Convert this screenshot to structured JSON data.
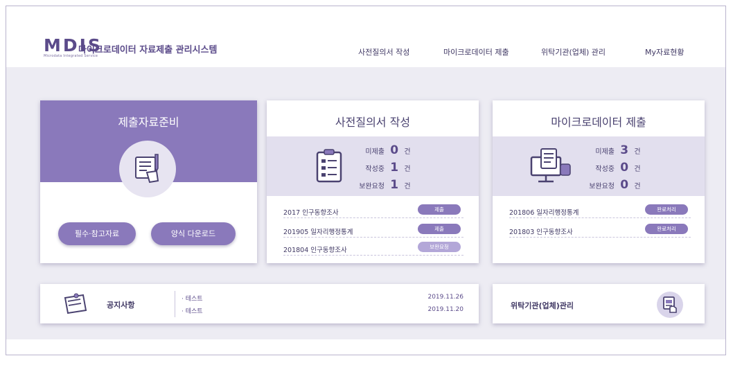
{
  "header": {
    "logo_mark": "MDIS",
    "logo_sub": "Microdata Integrated Service",
    "system_title": "마이크로데이터 자료제출 관리시스템",
    "nav": [
      "사전질의서 작성",
      "마이크로데이터 제출",
      "위탁기관(업체) 관리",
      "My자료현황"
    ]
  },
  "prepare": {
    "title": "제출자료준비",
    "btn_reference": "필수·참고자료",
    "btn_download": "양식 다운로드"
  },
  "questionnaire": {
    "title": "사전질의서 작성",
    "stats": [
      {
        "label": "미제출",
        "value": "0",
        "unit": "건"
      },
      {
        "label": "작성중",
        "value": "1",
        "unit": "건"
      },
      {
        "label": "보완요청",
        "value": "1",
        "unit": "건"
      }
    ],
    "rows": [
      {
        "text": "2017   인구동향조사",
        "badge": "제출"
      },
      {
        "text": "201905  일자리행정통계",
        "badge": "제출"
      },
      {
        "text": "201804  인구동향조사",
        "badge": "보완요청"
      }
    ]
  },
  "microdata": {
    "title": "마이크로데이터 제출",
    "stats": [
      {
        "label": "미제출",
        "value": "3",
        "unit": "건"
      },
      {
        "label": "작성중",
        "value": "0",
        "unit": "건"
      },
      {
        "label": "보완요청",
        "value": "0",
        "unit": "건"
      }
    ],
    "rows": [
      {
        "text": "201806  일자리행정통계",
        "badge": "완료처리"
      },
      {
        "text": "201803  인구동향조사",
        "badge": "완료처리"
      }
    ]
  },
  "notice": {
    "title": "공지사항",
    "items": [
      {
        "text": "· 테스트",
        "date": "2019.11.26"
      },
      {
        "text": "· 테스트",
        "date": "2019.11.20"
      }
    ]
  },
  "consign": {
    "title": "위탁기관(업체)관리"
  },
  "colors": {
    "accent": "#8a79bb",
    "accent_dark": "#5b4b8a",
    "band": "#e2dfee",
    "background": "#edecf3"
  },
  "icons": [
    "document-edit-icon",
    "checklist-icon",
    "monitor-data-icon",
    "notice-memo-icon",
    "consign-hand-icon"
  ]
}
